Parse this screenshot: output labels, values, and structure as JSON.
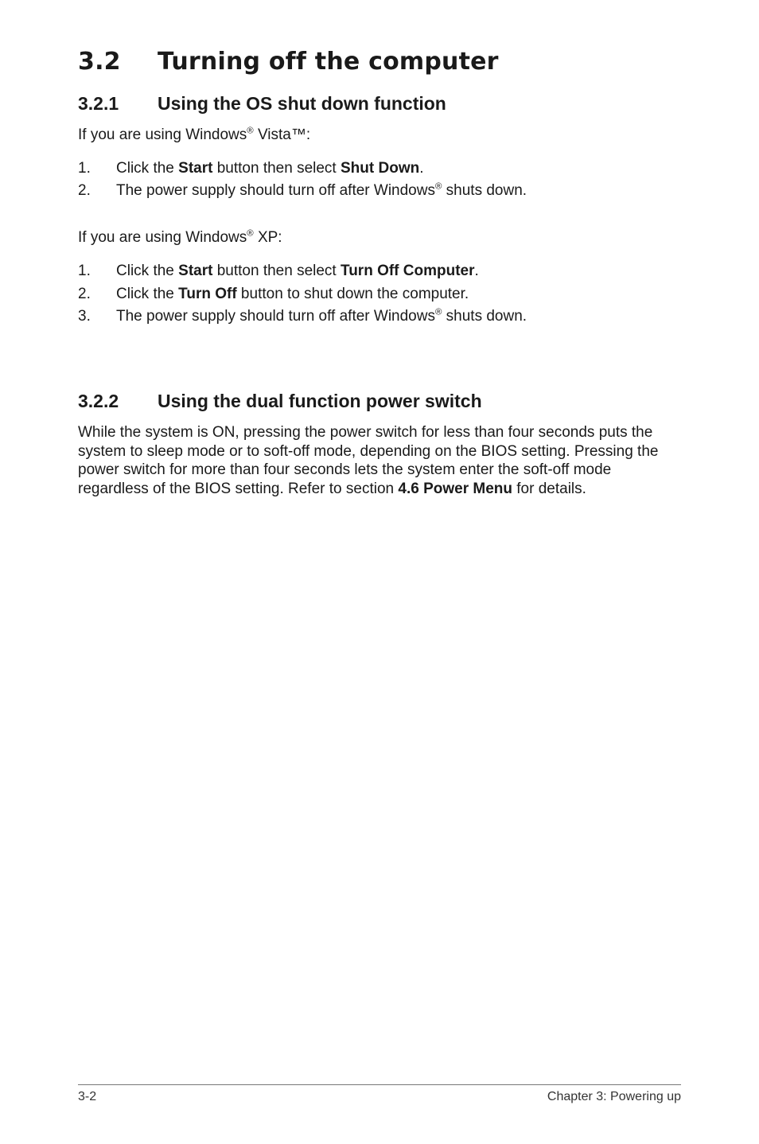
{
  "heading": {
    "number": "3.2",
    "title": "Turning off the computer"
  },
  "sections": [
    {
      "number": "3.2.1",
      "title": "Using the OS shut down function",
      "intro_vista": "If you are using Windows<sup>®</sup> Vista™:",
      "steps_vista": [
        "Click the <b>Start</b> button then select <b>Shut Down</b>.",
        "The power supply should turn off after Windows<sup>®</sup> shuts down."
      ],
      "intro_xp": "If you are using Windows<sup>®</sup> XP:",
      "steps_xp": [
        "Click the <b>Start</b> button then select <b>Turn Off Computer</b>.",
        "Click the <b>Turn Off</b> button to shut down the computer.",
        "The power supply should turn off after Windows<sup>®</sup> shuts down."
      ]
    },
    {
      "number": "3.2.2",
      "title": "Using the dual function power switch",
      "body": "While the system is ON, pressing the power switch for less than four seconds puts the system to sleep mode or to soft-off mode, depending on the BIOS setting. Pressing the power switch for more than four seconds lets the system enter the soft-off mode regardless of the BIOS setting. Refer to section <b>4.6 Power Menu</b> for details."
    }
  ],
  "footer": {
    "left": "3-2",
    "right": "Chapter 3: Powering up"
  }
}
